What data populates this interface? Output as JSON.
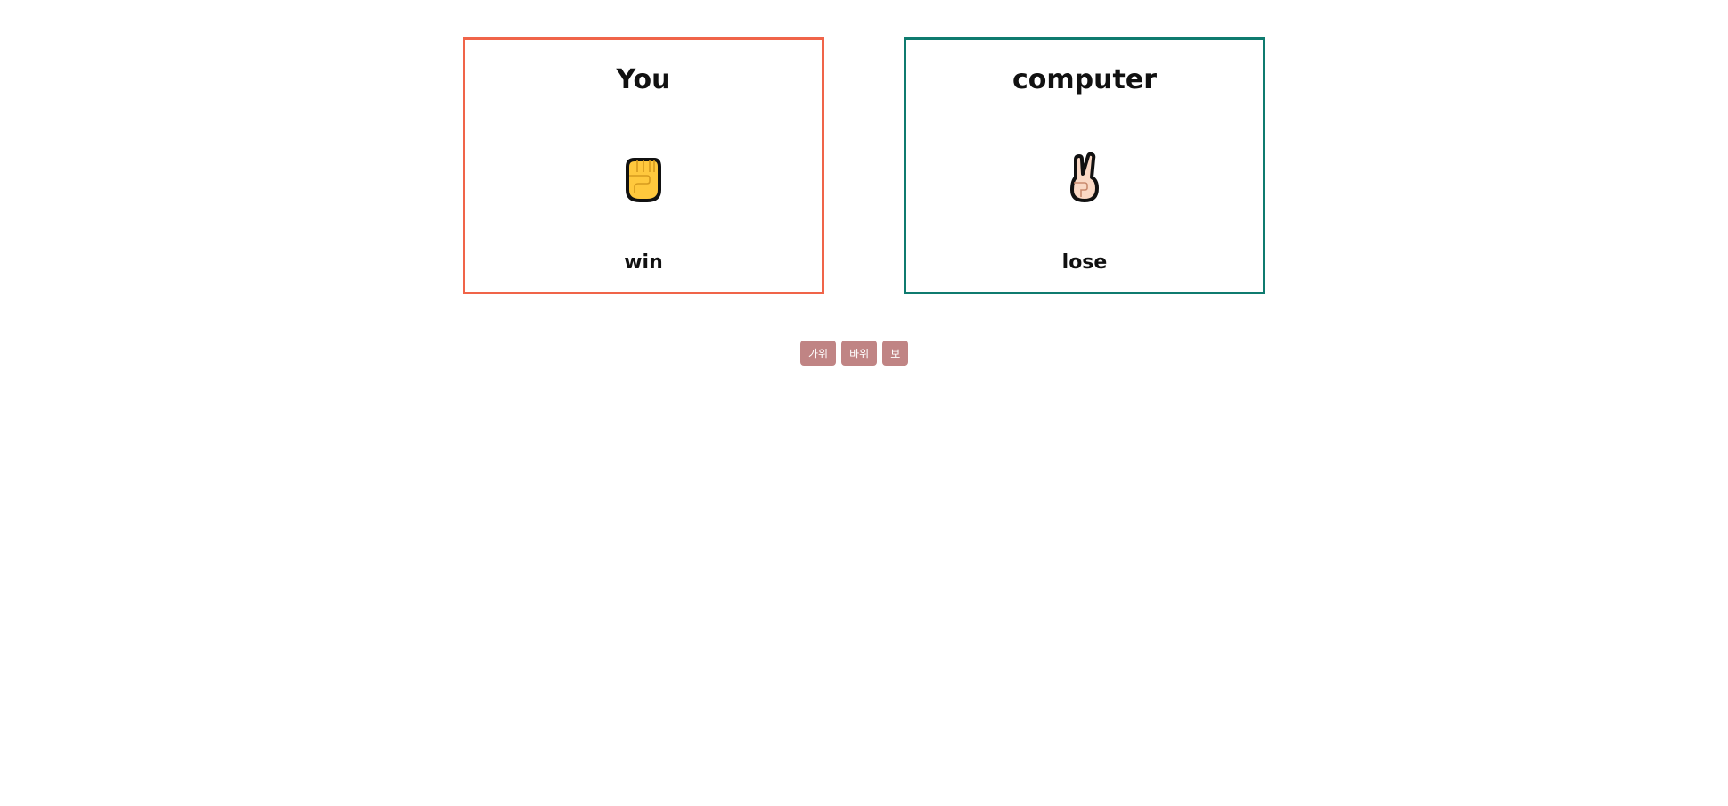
{
  "user_card": {
    "title": "You",
    "hand_icon": "rock-fist-icon",
    "result": "win",
    "border_color": "#f06449"
  },
  "computer_card": {
    "title": "computer",
    "hand_icon": "scissors-victory-hand-icon",
    "result": "lose",
    "border_color": "#0f7b6f"
  },
  "controls": {
    "buttons": [
      {
        "label": "가위"
      },
      {
        "label": "바위"
      },
      {
        "label": "보"
      }
    ],
    "button_color": "#c08484"
  }
}
